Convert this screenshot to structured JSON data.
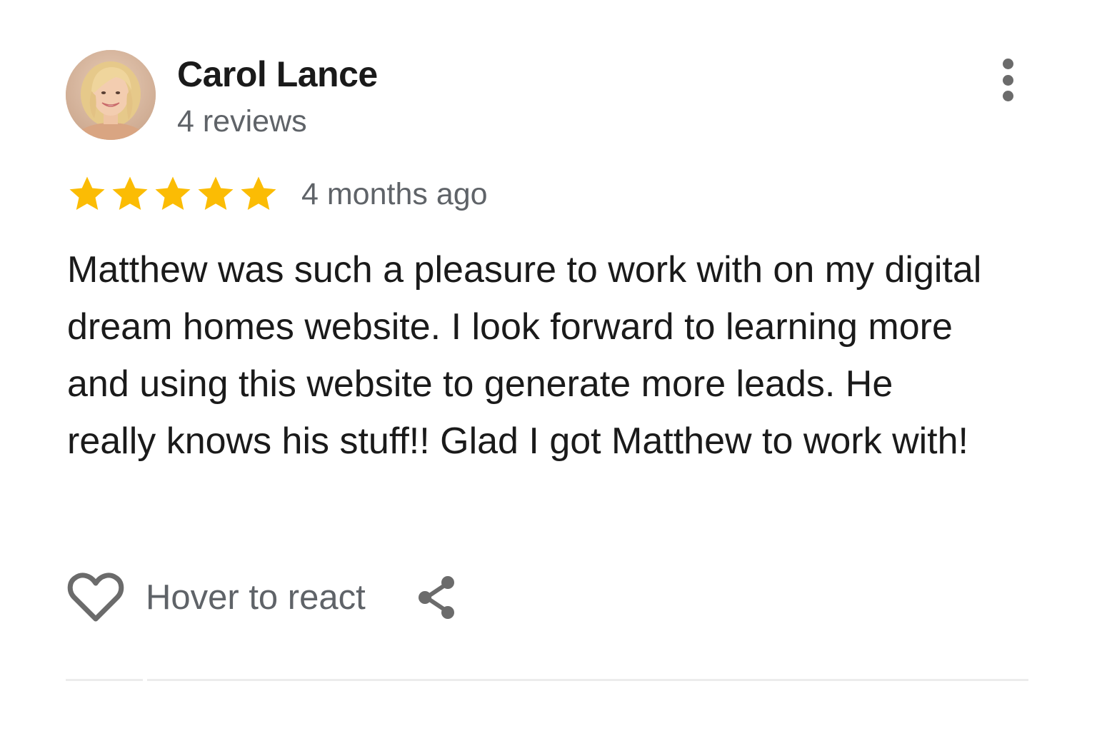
{
  "review": {
    "author": {
      "name": "Carol Lance",
      "review_count": "4 reviews",
      "avatar_icon": "profile-photo"
    },
    "rating": 5,
    "rating_max": 5,
    "date": "4 months ago",
    "text": "Matthew was such a pleasure to work with on my digital dream homes website. I look forward to learning more and using this website to generate more leads. He really knows his stuff!! Glad I got Matthew to work with!",
    "actions": {
      "react_label": "Hover to react",
      "react_icon": "heart-icon",
      "share_icon": "share-icon",
      "more_icon": "more-vert-icon"
    }
  },
  "colors": {
    "star": "#fbbc04",
    "text_primary": "#1a1a1a",
    "text_secondary": "#5f6368",
    "icon": "#6b6b6b",
    "divider": "#ececec"
  }
}
